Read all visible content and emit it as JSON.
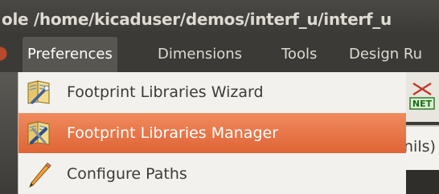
{
  "window": {
    "title": "ole /home/kicaduser/demos/interf_u/interf_u"
  },
  "menubar": {
    "items": [
      {
        "label": "Preferences",
        "open": true
      },
      {
        "label": "Dimensions"
      },
      {
        "label": "Tools"
      },
      {
        "label": "Design Ru"
      }
    ]
  },
  "dropdown": {
    "items": [
      {
        "label": "Footprint Libraries Wizard",
        "icon": "library-wizard-icon",
        "highlighted": false
      },
      {
        "label": "Footprint Libraries Manager",
        "icon": "library-manager-icon",
        "highlighted": true
      },
      {
        "label": "Configure Paths",
        "icon": "pencil-icon",
        "highlighted": false
      }
    ]
  },
  "background": {
    "field_text": "nils)",
    "toolbar_icon": "netlist-icon"
  },
  "colors": {
    "highlight": "#e9703f",
    "menu_bg": "#f2f1ee",
    "titlebar": "#3c3b37"
  }
}
